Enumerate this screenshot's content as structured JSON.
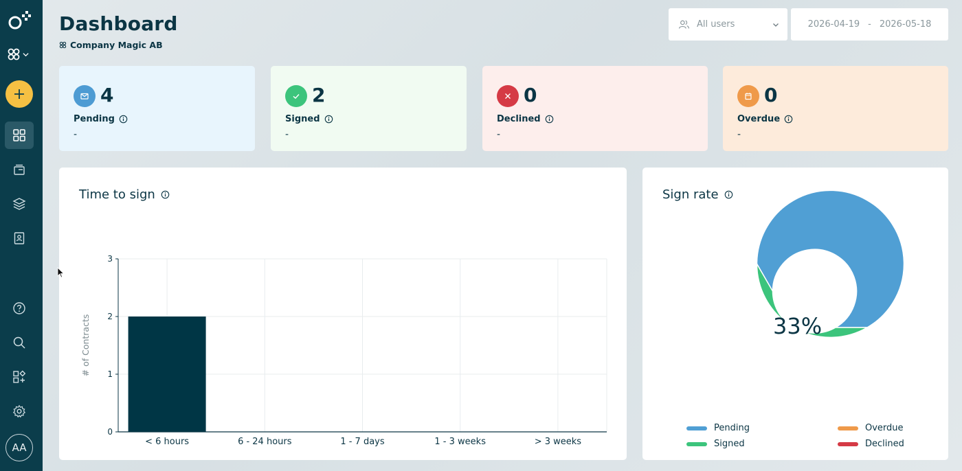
{
  "header": {
    "title": "Dashboard",
    "company": "Company Magic AB",
    "users_filter": "All users",
    "date_from": "2026-04-19",
    "date_sep": "-",
    "date_to": "2026-05-18"
  },
  "sidebar": {
    "avatar_initials": "AA",
    "items": [
      {
        "name": "dashboard-icon",
        "active": true
      },
      {
        "name": "documents-icon",
        "active": false
      },
      {
        "name": "templates-icon",
        "active": false
      },
      {
        "name": "contacts-icon",
        "active": false
      },
      {
        "name": "help-icon",
        "active": false
      },
      {
        "name": "search-icon",
        "active": false
      },
      {
        "name": "integrations-icon",
        "active": false
      },
      {
        "name": "settings-icon",
        "active": false
      }
    ]
  },
  "stats": [
    {
      "key": "pending",
      "count": "4",
      "label": "Pending",
      "sub": "-",
      "bg": "#e8f5fd",
      "icon_color": "#4d9bd3",
      "icon": "mail-icon"
    },
    {
      "key": "signed",
      "count": "2",
      "label": "Signed",
      "sub": "-",
      "bg": "#f1fbf2",
      "icon_color": "#3cc47c",
      "icon": "check-icon"
    },
    {
      "key": "declined",
      "count": "0",
      "label": "Declined",
      "sub": "-",
      "bg": "#fdeeec",
      "icon_color": "#d53a45",
      "icon": "x-icon"
    },
    {
      "key": "overdue",
      "count": "0",
      "label": "Overdue",
      "sub": "-",
      "bg": "#fdebdb",
      "icon_color": "#ef9a4a",
      "icon": "calendar-icon"
    }
  ],
  "time_to_sign": {
    "title": "Time to sign"
  },
  "sign_rate": {
    "title": "Sign rate",
    "center_text": "33%",
    "legend": [
      {
        "label": "Pending",
        "color": "#509fd4"
      },
      {
        "label": "Overdue",
        "color": "#ef9a4a"
      },
      {
        "label": "Signed",
        "color": "#3cc47c"
      },
      {
        "label": "Declined",
        "color": "#d53a45"
      }
    ]
  },
  "chart_data": [
    {
      "type": "bar",
      "title": "Time to sign",
      "ylabel": "# of Contracts",
      "xlabel": "",
      "categories": [
        "< 6 hours",
        "6 - 24 hours",
        "1 - 7 days",
        "1 - 3 weeks",
        "> 3 weeks"
      ],
      "values": [
        2,
        0,
        0,
        0,
        0
      ],
      "ylim": [
        0,
        3
      ],
      "yticks": [
        0,
        1,
        2,
        3
      ],
      "grid": true,
      "color": "#003645"
    },
    {
      "type": "pie",
      "title": "Sign rate",
      "labels": [
        "Pending",
        "Signed"
      ],
      "values": [
        4,
        2
      ],
      "colors": [
        "#509fd4",
        "#3cc47c"
      ],
      "center_label": "33%"
    }
  ]
}
